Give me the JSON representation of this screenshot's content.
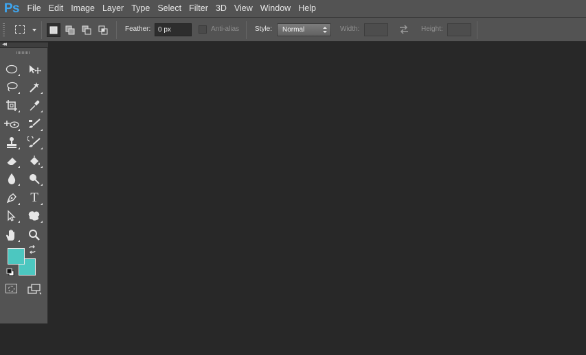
{
  "app": {
    "logo": "Ps",
    "accent_color": "#3ea6f0"
  },
  "menu": [
    {
      "label": "File"
    },
    {
      "label": "Edit"
    },
    {
      "label": "Image"
    },
    {
      "label": "Layer"
    },
    {
      "label": "Type"
    },
    {
      "label": "Select"
    },
    {
      "label": "Filter"
    },
    {
      "label": "3D"
    },
    {
      "label": "View"
    },
    {
      "label": "Window"
    },
    {
      "label": "Help"
    }
  ],
  "options": {
    "tool_icon": "rectangular-marquee-icon",
    "selection_modes": [
      {
        "icon": "new-selection-icon",
        "active": true
      },
      {
        "icon": "add-to-selection-icon",
        "active": false
      },
      {
        "icon": "subtract-from-selection-icon",
        "active": false
      },
      {
        "icon": "intersect-with-selection-icon",
        "active": false
      }
    ],
    "feather_label": "Feather:",
    "feather_value": "0 px",
    "antialias_label": "Anti-alias",
    "antialias_checked": false,
    "style_label": "Style:",
    "style_value": "Normal",
    "width_label": "Width:",
    "height_label": "Height:",
    "swap_icon": "swap-width-height-icon"
  },
  "tools": [
    {
      "icon": "elliptical-marquee-icon"
    },
    {
      "icon": "move-icon"
    },
    {
      "icon": "lasso-icon"
    },
    {
      "icon": "magic-wand-icon"
    },
    {
      "icon": "crop-icon"
    },
    {
      "icon": "eyedropper-icon"
    },
    {
      "icon": "spot-healing-icon"
    },
    {
      "icon": "brush-icon"
    },
    {
      "icon": "clone-stamp-icon"
    },
    {
      "icon": "history-brush-icon"
    },
    {
      "icon": "eraser-icon"
    },
    {
      "icon": "paint-bucket-icon"
    },
    {
      "icon": "blur-icon"
    },
    {
      "icon": "dodge-icon"
    },
    {
      "icon": "pen-icon"
    },
    {
      "icon": "type-icon",
      "glyph": "T"
    },
    {
      "icon": "path-selection-icon"
    },
    {
      "icon": "custom-shape-icon"
    },
    {
      "icon": "hand-icon"
    },
    {
      "icon": "zoom-icon"
    }
  ],
  "colors": {
    "foreground": "#4cc7c0",
    "background": "#4cc7c0"
  }
}
